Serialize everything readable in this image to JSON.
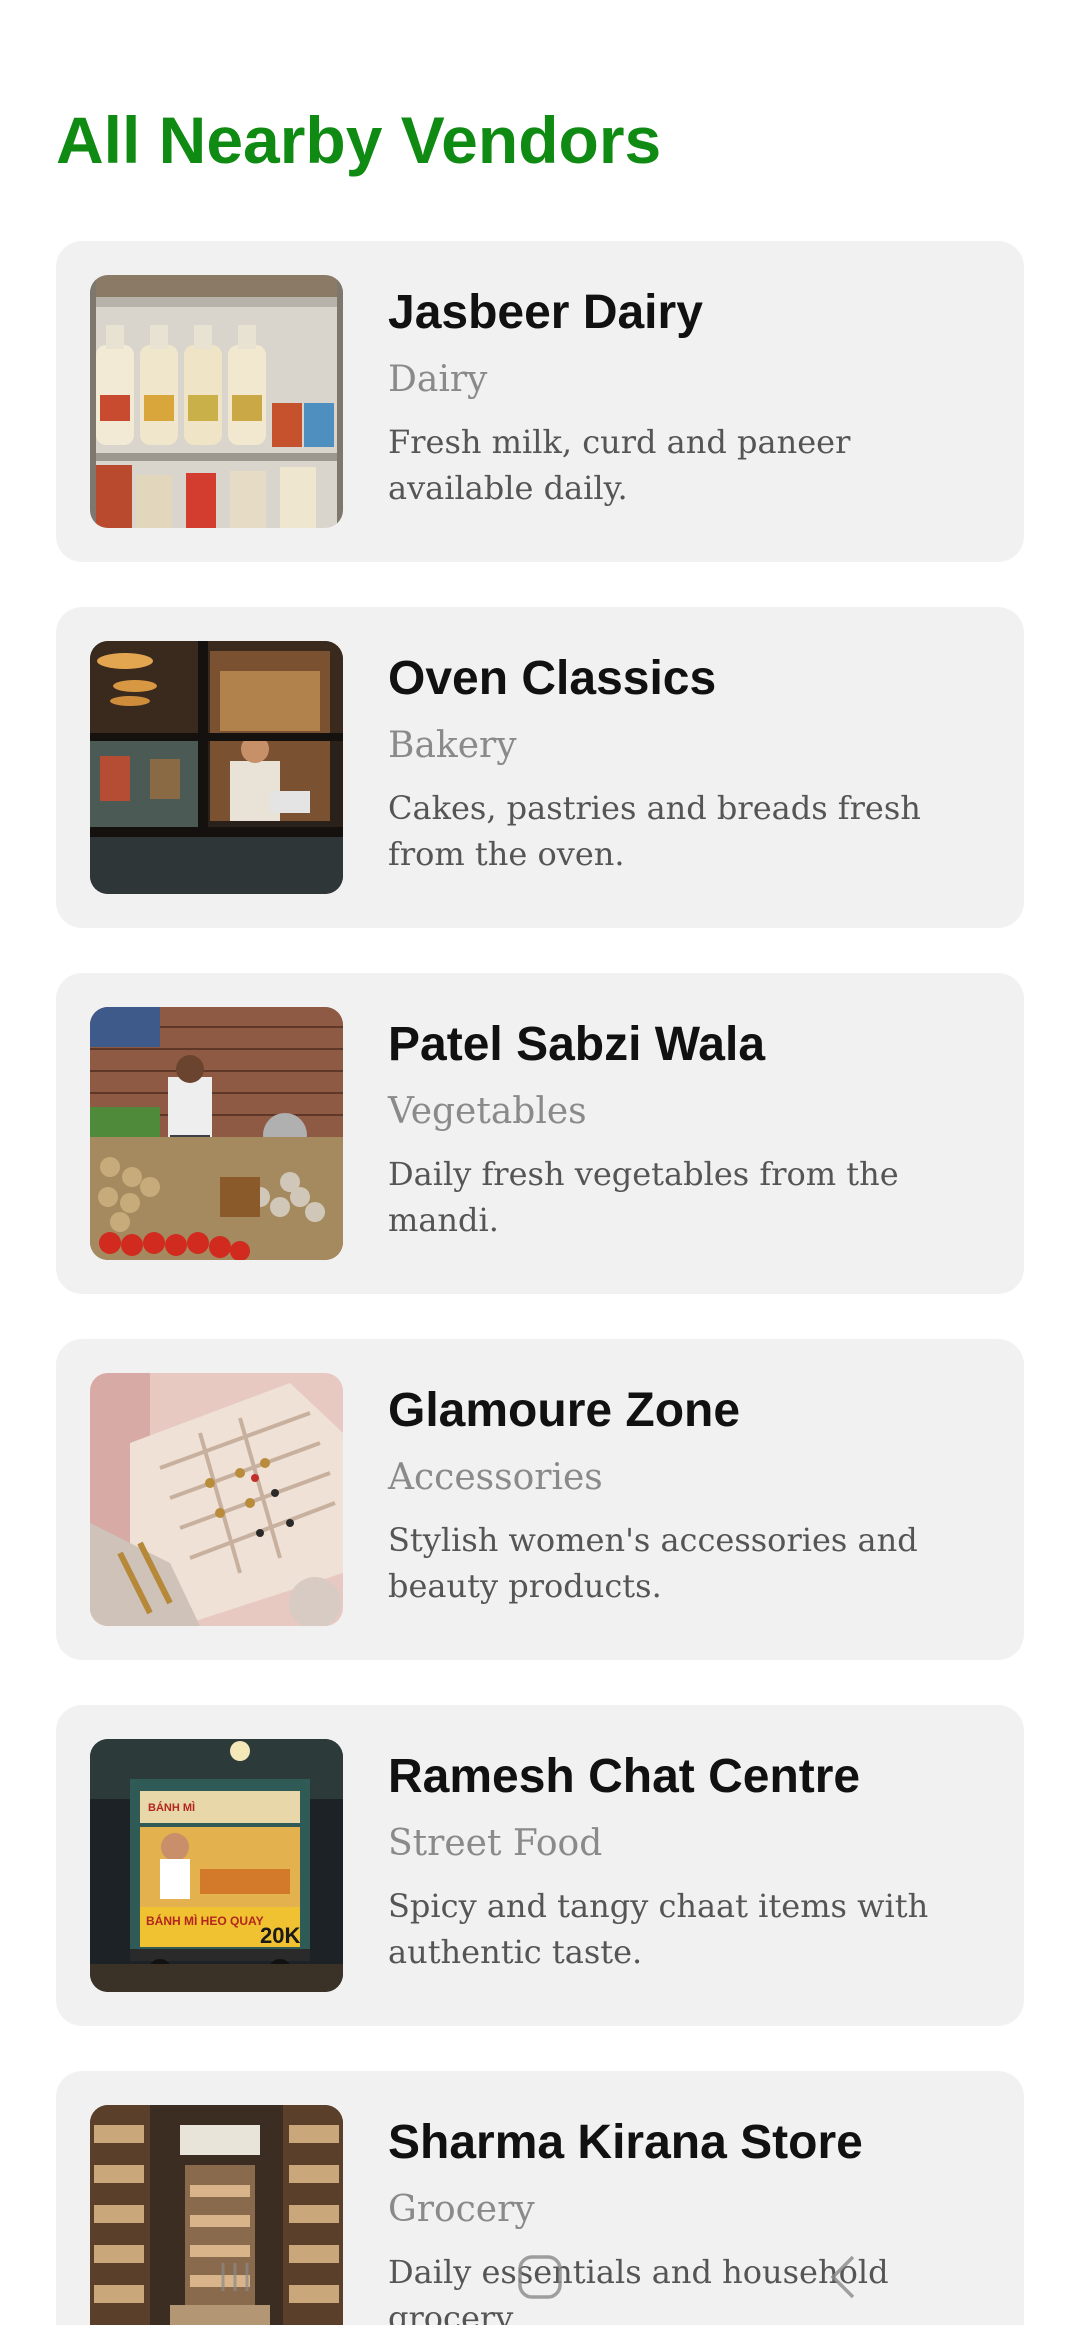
{
  "page": {
    "title": "All Nearby Vendors",
    "title_color": "#0f8a12"
  },
  "vendors": [
    {
      "name": "Jasbeer Dairy",
      "category": "Dairy",
      "description": "Fresh milk, curd and paneer available daily.",
      "image": "milk-bottles-photo"
    },
    {
      "name": "Oven Classics",
      "category": "Bakery",
      "description": "Cakes, pastries and breads fresh from the oven.",
      "image": "bakery-window-photo"
    },
    {
      "name": "Patel Sabzi Wala",
      "category": "Vegetables",
      "description": "Daily fresh vegetables from the mandi.",
      "image": "vegetable-stall-photo"
    },
    {
      "name": "Glamoure Zone",
      "category": "Accessories",
      "description": "Stylish women's accessories and beauty products.",
      "image": "jewelry-box-photo"
    },
    {
      "name": "Ramesh Chat Centre",
      "category": "Street Food",
      "description": "Spicy and tangy chaat items with authentic taste.",
      "image": "street-food-cart-photo",
      "photo_sign_text": "BÁNH MÌ HEO QUAY 20K"
    },
    {
      "name": "Sharma Kirana Store",
      "category": "Grocery",
      "description": "Daily essentials and household grocery.",
      "image": "grocery-aisle-photo"
    }
  ],
  "nav": {
    "icons": [
      "recents-icon",
      "home-icon",
      "back-icon"
    ]
  }
}
